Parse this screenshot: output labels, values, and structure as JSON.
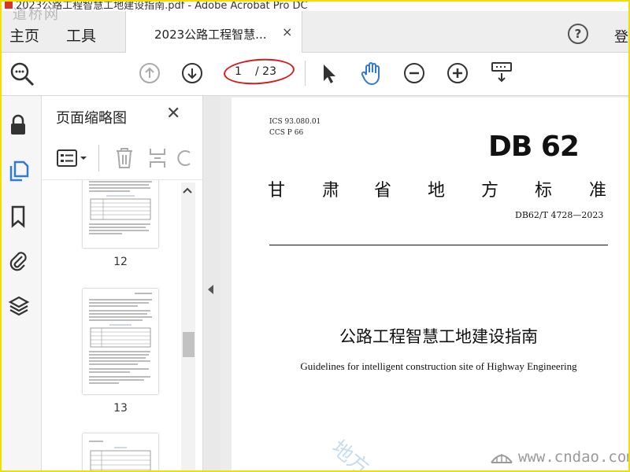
{
  "window": {
    "title": "2023公路工程智慧工地建设指南.pdf - Adobe Acrobat Pro DC"
  },
  "watermark": {
    "top_left": "道桥网",
    "site": "www.cndao.com"
  },
  "menu": {
    "home": "主页",
    "tools": "工具",
    "login": "登"
  },
  "tab": {
    "title": "2023公路工程智慧...",
    "close": "×"
  },
  "toolbar": {
    "page_current": "1",
    "page_total": "/ 23"
  },
  "panel": {
    "title": "页面缩略图",
    "close": "✕",
    "thumbnails": [
      {
        "label": "12"
      },
      {
        "label": "13"
      },
      {
        "label": ""
      }
    ]
  },
  "document": {
    "ics": "ICS  93.080.01",
    "ccs": "CCS  P  66",
    "logo": "DB 62",
    "province_chars": [
      "甘",
      "肃",
      "省",
      "地",
      "方",
      "标",
      "准"
    ],
    "standard_no": "DB62/T 4728—2023",
    "title_cn": "公路工程智慧工地建设指南",
    "title_en": "Guidelines for intelligent construction site of Highway Engineering"
  },
  "colors": {
    "accent": "#2f7ad3",
    "frame": "#f0e000",
    "oval": "#d31e1e"
  }
}
